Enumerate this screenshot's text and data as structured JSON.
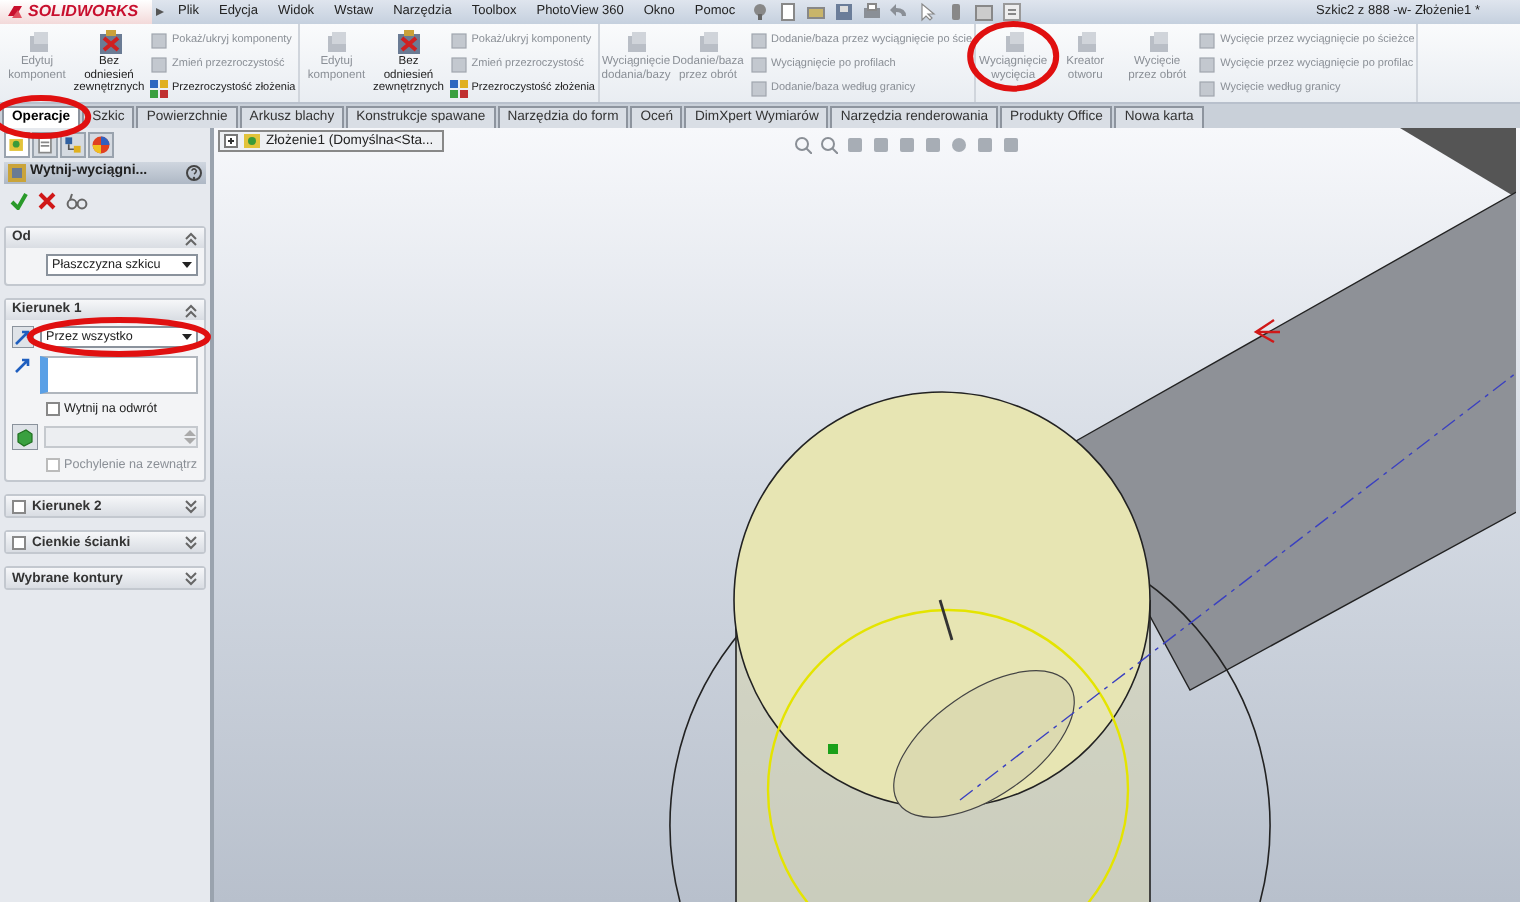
{
  "app": {
    "logo": "SOLIDWORKS",
    "menu": [
      "Plik",
      "Edycja",
      "Widok",
      "Wstaw",
      "Narzędzia",
      "Toolbox",
      "PhotoView 360",
      "Okno",
      "Pomoc"
    ],
    "title": "Szkic2 z 888 -w- Złożenie1 *"
  },
  "ribbon": {
    "groups": [
      {
        "items": [
          {
            "kind": "large",
            "label": "Edytuj komponent",
            "disabled": true
          },
          {
            "kind": "large",
            "label": "Bez odniesień zewnętrznych",
            "disabled": false
          },
          {
            "kind": "small",
            "label": "Pokaż/ukryj komponenty",
            "disabled": true
          },
          {
            "kind": "small",
            "label": "Zmień przezroczystość",
            "disabled": true
          },
          {
            "kind": "small",
            "label": "Przezroczystość złożenia",
            "disabled": false
          }
        ]
      },
      {
        "items": [
          {
            "kind": "large",
            "label": "Edytuj komponent",
            "disabled": true
          },
          {
            "kind": "large",
            "label": "Bez odniesień zewnętrznych",
            "disabled": false
          },
          {
            "kind": "small",
            "label": "Pokaż/ukryj komponenty",
            "disabled": true
          },
          {
            "kind": "small",
            "label": "Zmień przezroczystość",
            "disabled": true
          },
          {
            "kind": "small",
            "label": "Przezroczystość złożenia",
            "disabled": false
          }
        ]
      },
      {
        "items": [
          {
            "kind": "large",
            "label": "Wyciągnięcie dodania/bazy",
            "disabled": true
          },
          {
            "kind": "large",
            "label": "Dodanie/baza przez obrót",
            "disabled": true
          },
          {
            "kind": "small",
            "label": "Dodanie/baza przez wyciągnięcie po ście",
            "disabled": true
          },
          {
            "kind": "small",
            "label": "Wyciągnięcie po profilach",
            "disabled": true
          },
          {
            "kind": "small",
            "label": "Dodanie/baza według granicy",
            "disabled": true
          }
        ]
      },
      {
        "items": [
          {
            "kind": "large",
            "label": "Wyciągnięcie wycięcia",
            "disabled": true
          },
          {
            "kind": "large",
            "label": "Kreator otworu",
            "disabled": true
          },
          {
            "kind": "large",
            "label": "Wycięcie przez obrót",
            "disabled": true
          },
          {
            "kind": "small",
            "label": "Wycięcie przez wyciągnięcie po ścieżce",
            "disabled": true
          },
          {
            "kind": "small",
            "label": "Wycięcie przez wyciągnięcie po profilac",
            "disabled": true
          },
          {
            "kind": "small",
            "label": "Wycięcie według granicy",
            "disabled": true
          }
        ]
      }
    ]
  },
  "tabs": [
    {
      "label": "Operacje",
      "selected": true
    },
    {
      "label": "Szkic",
      "selected": false
    },
    {
      "label": "Powierzchnie",
      "selected": false
    },
    {
      "label": "Arkusz blachy",
      "selected": false
    },
    {
      "label": "Konstrukcje spawane",
      "selected": false
    },
    {
      "label": "Narzędzia do form",
      "selected": false
    },
    {
      "label": "Oceń",
      "selected": false
    },
    {
      "label": "DimXpert Wymiarów",
      "selected": false
    },
    {
      "label": "Narzędzia renderowania",
      "selected": false
    },
    {
      "label": "Produkty Office",
      "selected": false
    },
    {
      "label": "Nowa karta",
      "selected": false
    }
  ],
  "property_manager": {
    "title": "Wytnij-wyciągni...",
    "sections": [
      {
        "title": "Od",
        "expanded": true,
        "fields": [
          {
            "kind": "select",
            "value": "Płaszczyzna szkicu"
          }
        ]
      },
      {
        "title": "Kierunek 1",
        "expanded": true,
        "fields": [
          {
            "kind": "select",
            "value": "Przez wszystko"
          },
          {
            "kind": "listbox"
          },
          {
            "kind": "checkbox",
            "label": "Wytnij na odwrót",
            "checked": false,
            "disabled": false
          },
          {
            "kind": "spinner",
            "disabled": true
          },
          {
            "kind": "checkbox",
            "label": "Pochylenie na zewnątrz",
            "checked": false,
            "disabled": true
          }
        ]
      },
      {
        "title": "Kierunek 2",
        "expanded": false,
        "checked": false
      },
      {
        "title": "Cienkie ścianki",
        "expanded": false,
        "checked": false
      },
      {
        "title": "Wybrane kontury",
        "expanded": false
      }
    ]
  },
  "viewport": {
    "tree_item": "Złożenie1 (Domyślna<Sta..."
  }
}
